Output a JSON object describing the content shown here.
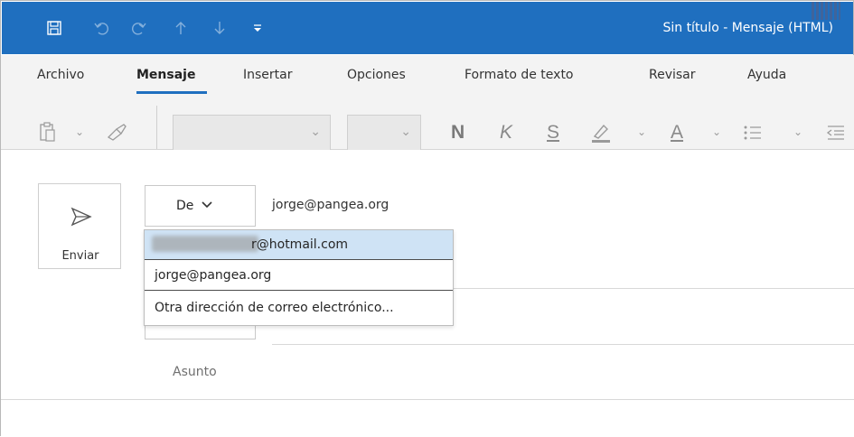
{
  "window": {
    "title": "Sin título  -  Mensaje (HTML)"
  },
  "quick_access": {
    "icons": [
      "save-icon",
      "undo-icon",
      "redo-icon",
      "up-arrow-icon",
      "down-arrow-icon",
      "customize-icon"
    ]
  },
  "ribbon": {
    "tabs": [
      {
        "label": "Archivo"
      },
      {
        "label": "Mensaje",
        "active": true
      },
      {
        "label": "Insertar"
      },
      {
        "label": "Opciones"
      },
      {
        "label": "Formato de texto"
      },
      {
        "label": "Revisar"
      },
      {
        "label": "Ayuda"
      }
    ],
    "toolbar": {
      "bold": "N",
      "italic": "K",
      "underline": "S",
      "font_color": "A"
    }
  },
  "compose": {
    "send_label": "Enviar",
    "from_label": "De",
    "from_value": "jorge@pangea.org",
    "subject_placeholder": "Asunto"
  },
  "from_dropdown": {
    "items": [
      {
        "label": "r@hotmail.com",
        "selected": true
      },
      {
        "label": "jorge@pangea.org"
      },
      {
        "label": "Otra dirección de correo electrónico..."
      }
    ]
  },
  "colors": {
    "titlebar": "#1f6fbf",
    "accent": "#1f6fbf",
    "selection": "#cfe3f5"
  }
}
